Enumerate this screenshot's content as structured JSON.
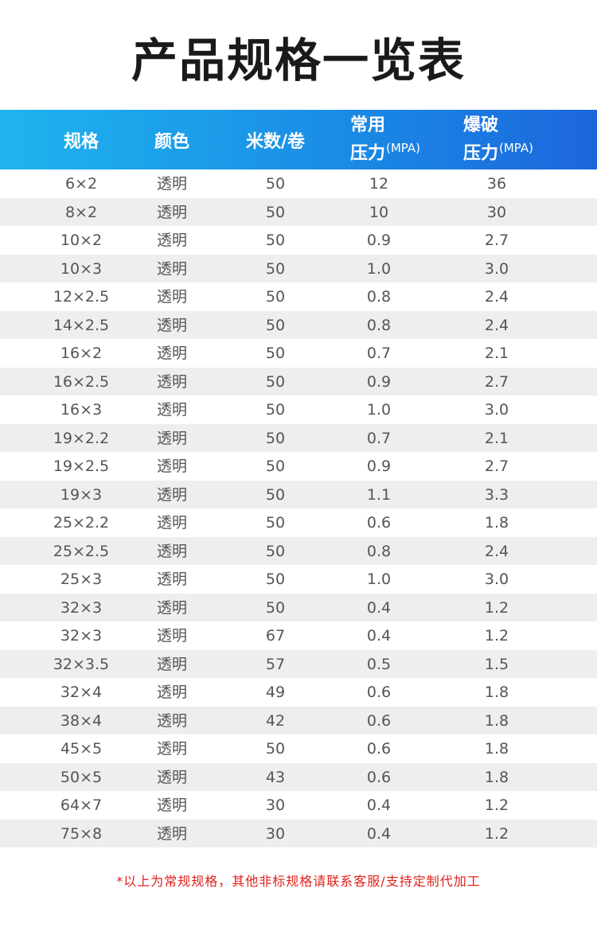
{
  "title": "产品规格一览表",
  "header": {
    "spec": "规格",
    "color": "颜色",
    "meters": "米数/卷",
    "working_line1": "常用",
    "working_line2": "压力",
    "working_unit": "(MPA)",
    "burst_line1": "爆破",
    "burst_line2": "压力",
    "burst_unit": "(MPA)"
  },
  "rows": [
    [
      "6×2",
      "透明",
      "50",
      "12",
      "36"
    ],
    [
      "8×2",
      "透明",
      "50",
      "10",
      "30"
    ],
    [
      "10×2",
      "透明",
      "50",
      "0.9",
      "2.7"
    ],
    [
      "10×3",
      "透明",
      "50",
      "1.0",
      "3.0"
    ],
    [
      "12×2.5",
      "透明",
      "50",
      "0.8",
      "2.4"
    ],
    [
      "14×2.5",
      "透明",
      "50",
      "0.8",
      "2.4"
    ],
    [
      "16×2",
      "透明",
      "50",
      "0.7",
      "2.1"
    ],
    [
      "16×2.5",
      "透明",
      "50",
      "0.9",
      "2.7"
    ],
    [
      "16×3",
      "透明",
      "50",
      "1.0",
      "3.0"
    ],
    [
      "19×2.2",
      "透明",
      "50",
      "0.7",
      "2.1"
    ],
    [
      "19×2.5",
      "透明",
      "50",
      "0.9",
      "2.7"
    ],
    [
      "19×3",
      "透明",
      "50",
      "1.1",
      "3.3"
    ],
    [
      "25×2.2",
      "透明",
      "50",
      "0.6",
      "1.8"
    ],
    [
      "25×2.5",
      "透明",
      "50",
      "0.8",
      "2.4"
    ],
    [
      "25×3",
      "透明",
      "50",
      "1.0",
      "3.0"
    ],
    [
      "32×3",
      "透明",
      "50",
      "0.4",
      "1.2"
    ],
    [
      "32×3",
      "透明",
      "67",
      "0.4",
      "1.2"
    ],
    [
      "32×3.5",
      "透明",
      "57",
      "0.5",
      "1.5"
    ],
    [
      "32×4",
      "透明",
      "49",
      "0.6",
      "1.8"
    ],
    [
      "38×4",
      "透明",
      "42",
      "0.6",
      "1.8"
    ],
    [
      "45×5",
      "透明",
      "50",
      "0.6",
      "1.8"
    ],
    [
      "50×5",
      "透明",
      "43",
      "0.6",
      "1.8"
    ],
    [
      "64×7",
      "透明",
      "30",
      "0.4",
      "1.2"
    ],
    [
      "75×8",
      "透明",
      "30",
      "0.4",
      "1.2"
    ]
  ],
  "note": "*以上为常规规格，其他非标规格请联系客服/支持定制代加工",
  "colors": {
    "header_start": "#1fb4ee",
    "header_end": "#1c66dc",
    "row_alt": "#eeeeee",
    "note": "#e0221c"
  }
}
